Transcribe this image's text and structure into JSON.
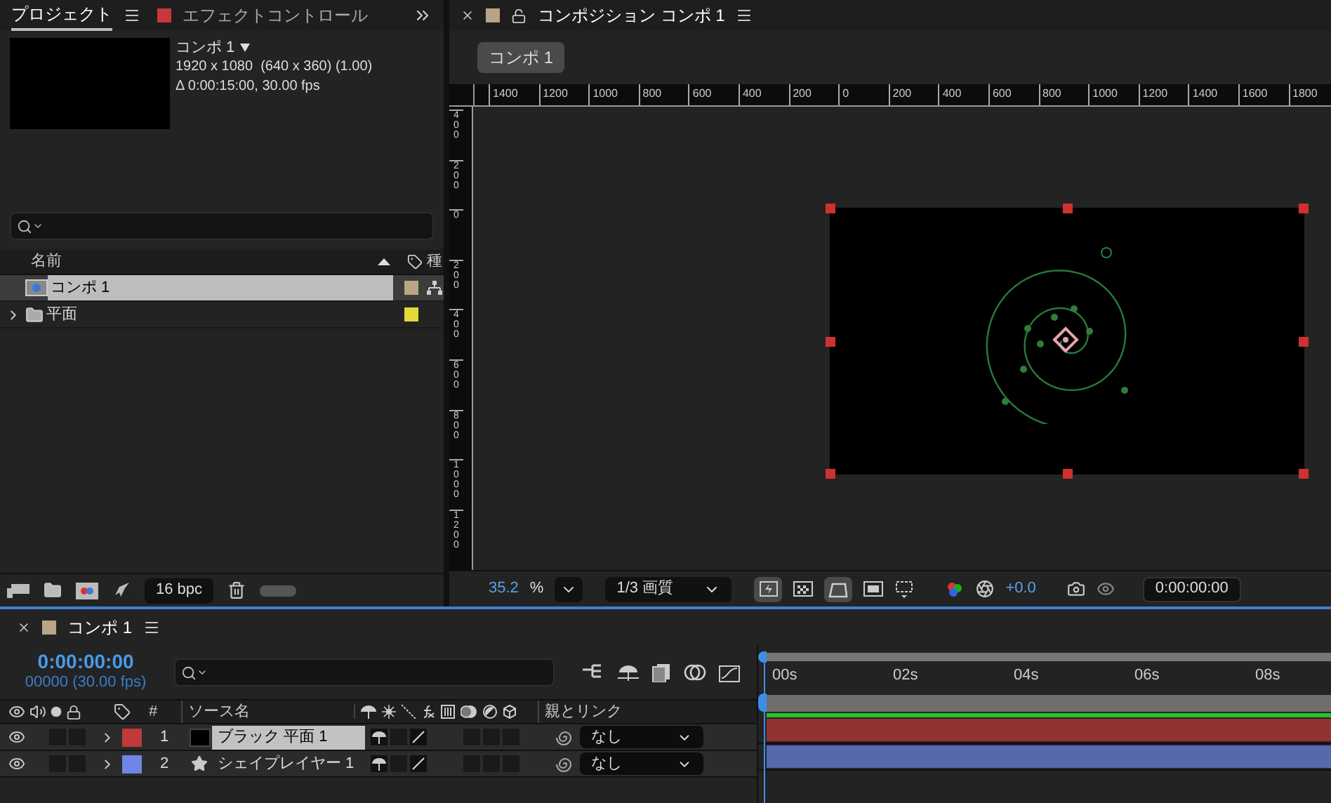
{
  "project": {
    "tabs": [
      {
        "label": "プロジェクト",
        "selected": true
      },
      {
        "label": "エフェクトコントロール",
        "selected": false,
        "color": "#c8373c"
      }
    ],
    "preview": {
      "name": "コンポ 1",
      "details": [
        "1920 x 1080  (640 x 360) (1.00)",
        "Δ 0:00:15:00, 30.00 fps"
      ]
    },
    "columns": [
      "名前",
      "種"
    ],
    "items": [
      {
        "name": "コンポ 1",
        "kind": "comp",
        "selected": true,
        "color": "#b8a587"
      },
      {
        "name": "平面",
        "kind": "folder",
        "selected": false,
        "expanded": false,
        "color": "#e6d83a"
      }
    ],
    "bpc": "16 bpc"
  },
  "composition": {
    "title": "コンポジション コンポ 1",
    "color": "#b8a587",
    "breadcrumb": "コンポ 1",
    "ruler_h": [
      "1400",
      "1200",
      "1000",
      "800",
      "600",
      "400",
      "200",
      "0",
      "200",
      "400",
      "600",
      "800",
      "1000",
      "1200",
      "1400",
      "1600",
      "1800"
    ],
    "ruler_v": [
      "400",
      "200",
      "0",
      "200",
      "400",
      "600",
      "800",
      "1000",
      "1200"
    ],
    "zoom": "35.2",
    "zoom_unit": "%",
    "resolution": "1/3 画質",
    "exposure": "+0.0",
    "timecode": "0:00:00:00"
  },
  "timeline": {
    "title": "コンポ 1",
    "color": "#b8a587",
    "timecode": "0:00:00:00",
    "frames": "00000 (30.00 fps)",
    "columns": [
      "#",
      "ソース名",
      "親とリンク"
    ],
    "ticks": [
      "00s",
      "02s",
      "04s",
      "06s",
      "08s"
    ],
    "layers": [
      {
        "number": "1",
        "name": "ブラック 平面 1",
        "kind": "solid",
        "selected": true,
        "color": "#c0393b",
        "parent": "なし"
      },
      {
        "number": "2",
        "name": "シェイプレイヤー 1",
        "kind": "shape",
        "selected": false,
        "color": "#6f86e8",
        "parent": "なし"
      }
    ]
  }
}
